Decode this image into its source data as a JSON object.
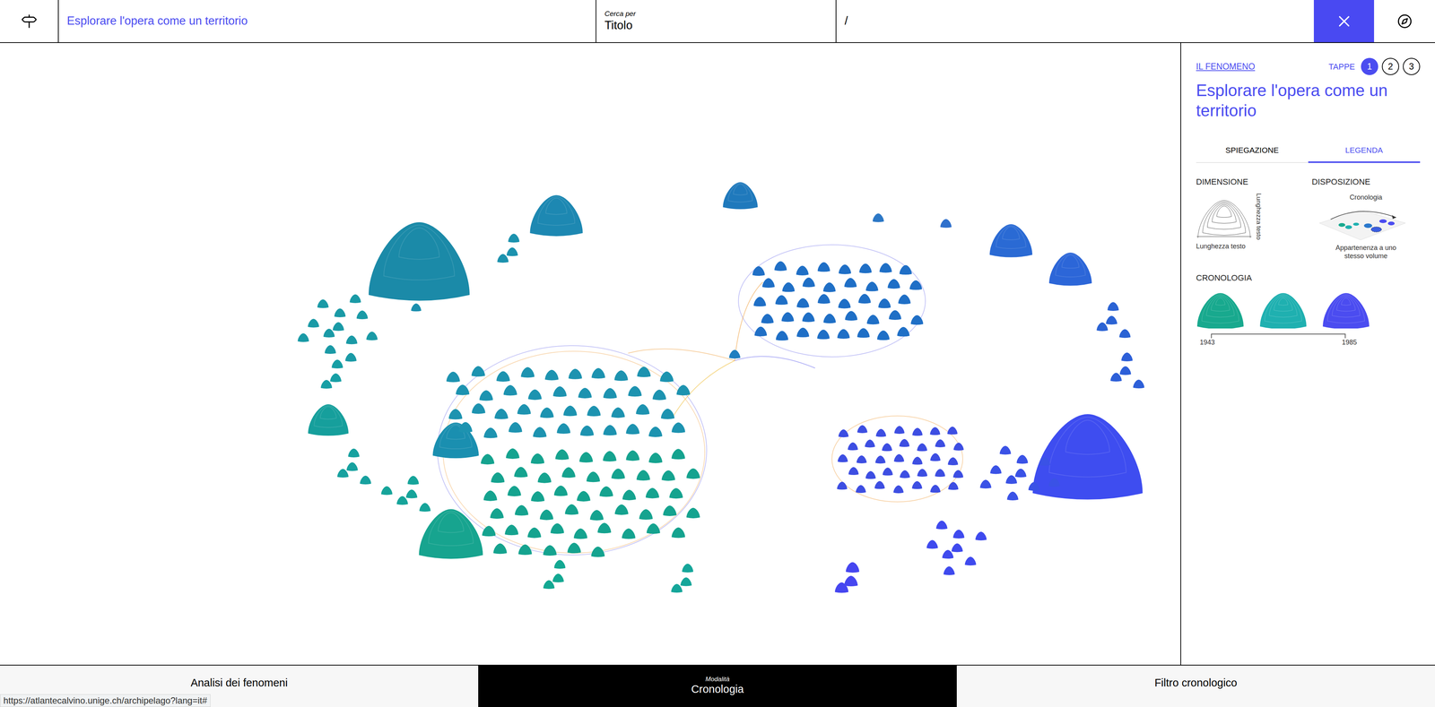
{
  "topbar": {
    "title": "Esplorare l'opera come un territorio",
    "search_label": "Cerca per",
    "search_value": "Titolo",
    "path": "/"
  },
  "map": {
    "islands": [
      {
        "color": "#1b8aa8",
        "count": 1,
        "level": 0.9
      },
      {
        "color": "#1d88b2",
        "count": 1,
        "level": 0.47
      },
      {
        "color": "#1f79bc",
        "count": 1,
        "level": 0.31
      },
      {
        "color": "#17a48f",
        "count": 1,
        "level": 0.57
      },
      {
        "color": "#169f9c",
        "count": 1,
        "level": 0.36
      },
      {
        "color": "#1a8fb0",
        "count": 1,
        "level": 0.41
      },
      {
        "color": "#3e4df0",
        "count": 1,
        "level": 0.98
      },
      {
        "color": "#2a6ad4",
        "count": 1,
        "level": 0.38
      },
      {
        "color": "#2c66d8",
        "count": 1,
        "level": 0.38
      },
      {
        "color": "#1d93b0",
        "count": 40,
        "level": 0.12
      },
      {
        "color": "#15a38f",
        "count": 50,
        "level": 0.12
      },
      {
        "color": "#1f6fc6",
        "count": 40,
        "level": 0.11
      },
      {
        "color": "#3d4ee2",
        "count": 35,
        "level": 0.09
      },
      {
        "color": "#1a9aa6",
        "count": 12,
        "level": 0.1
      },
      {
        "color": "#179fa5",
        "count": 3,
        "level": 0.1
      },
      {
        "color": "#17a19f",
        "count": 4,
        "level": 0.1
      },
      {
        "color": "#16a49a",
        "count": 5,
        "level": 0.1
      },
      {
        "color": "#1c92ae",
        "count": 3,
        "level": 0.1
      },
      {
        "color": "#13a892",
        "count": 3,
        "level": 0.1
      },
      {
        "color": "#15a69a",
        "count": 3,
        "level": 0.1
      },
      {
        "color": "#2b63d4",
        "count": 4,
        "level": 0.1
      },
      {
        "color": "#2d5fd8",
        "count": 4,
        "level": 0.1
      },
      {
        "color": "#3a52e6",
        "count": 10,
        "level": 0.1
      },
      {
        "color": "#3f4aee",
        "count": 8,
        "level": 0.1
      },
      {
        "color": "#4646f0",
        "count": 3,
        "level": 0.12
      },
      {
        "color": "#2d78c6",
        "count": 1,
        "level": 0.1
      },
      {
        "color": "#2f70cc",
        "count": 1,
        "level": 0.1
      },
      {
        "color": "#1b8fae",
        "count": 1,
        "level": 0.09
      },
      {
        "color": "#1f7ec0",
        "count": 1,
        "level": 0.1
      }
    ]
  },
  "panel": {
    "link": "IL FENOMENO",
    "steps_label": "TAPPE",
    "steps": [
      {
        "label": "1",
        "selected": true
      },
      {
        "label": "2",
        "selected": false
      },
      {
        "label": "3",
        "selected": false
      }
    ],
    "title": "Esplorare l'opera come un territorio",
    "tabs": [
      {
        "label": "SPIEGAZIONE",
        "selected": false
      },
      {
        "label": "LEGENDA",
        "selected": true
      }
    ],
    "legend": {
      "dimension": {
        "title": "DIMENSIONE",
        "height_label": "Lunghezza testo",
        "width_label": "Lunghezza testo"
      },
      "layout": {
        "title": "DISPOSIZIONE",
        "top_label": "Cronologia",
        "bottom_label": "Appartenenza a uno stesso volume"
      },
      "chronology": {
        "title": "CRONOLOGIA",
        "colors": [
          "#18a98e",
          "#1fb0b0",
          "#4b4cf0"
        ],
        "start": "1943",
        "end": "1985"
      }
    }
  },
  "bottom": {
    "items": [
      {
        "caption": "",
        "label": "Analisi dei fenomeni",
        "selected": false
      },
      {
        "caption": "Modalità",
        "label": "Cronologia",
        "selected": true
      },
      {
        "caption": "",
        "label": "Filtro cronologico",
        "selected": false
      }
    ]
  },
  "status_url": "https://atlantecalvino.unige.ch/archipelago?lang=it#"
}
